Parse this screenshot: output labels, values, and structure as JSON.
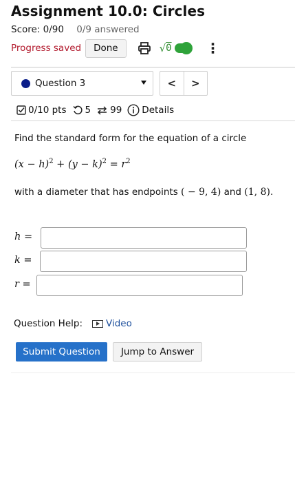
{
  "header": {
    "title": "Assignment 10.0: Circles",
    "score": "Score: 0/90",
    "answered": "0/9 answered",
    "progress_saved": "Progress saved",
    "done_label": "Done",
    "sqrt_label": "√",
    "sqrt_radicand": "0",
    "more_glyph": "⋮",
    "icons": [
      "print-icon",
      "math-toggle-icon",
      "more-vertical-icon"
    ],
    "toggle_color": "#2fa33a"
  },
  "question_nav": {
    "selected": "Question 3",
    "prev_glyph": "<",
    "next_glyph": ">"
  },
  "meta": {
    "points": "0/10 pts",
    "retries": "5",
    "attempts": "99",
    "details": "Details"
  },
  "question": {
    "prompt": "Find the standard form for the equation of a circle",
    "formula_parts": [
      "(x − h)",
      "2",
      " + (y − k)",
      "2",
      " = r",
      "2"
    ],
    "diameter_prefix": "with a diameter that has endpoints ",
    "endpoint_1": "( − 9, 4)",
    "conjunction": " and ",
    "endpoint_2": "(1, 8)",
    "period": "."
  },
  "answers": [
    {
      "label": "h =",
      "value": ""
    },
    {
      "label": "k =",
      "value": ""
    },
    {
      "label": "r =",
      "value": ""
    }
  ],
  "help": {
    "label": "Question Help:",
    "video_label": "Video"
  },
  "actions": {
    "submit_label": "Submit Question",
    "jump_label": "Jump to Answer"
  },
  "colors": {
    "progress_saved": "#b2192c",
    "submit_bg": "#2671c9",
    "link": "#1d4f9c",
    "question_dot": "#0b1e8a"
  }
}
